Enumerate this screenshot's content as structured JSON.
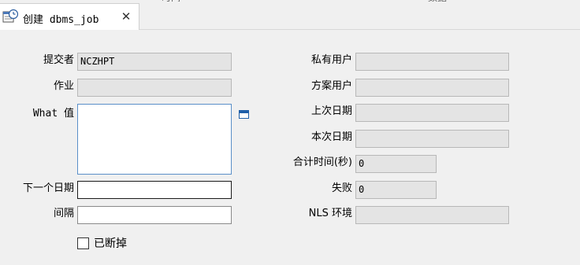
{
  "tab": {
    "title": "创建 dbms_job",
    "close_glyph": "✕",
    "icon": "calendar-clock-icon"
  },
  "top_fragments": [
    "时间",
    "数据"
  ],
  "form": {
    "submitter": {
      "label": "提交者",
      "value": "NCZHPT"
    },
    "job": {
      "label": "作业",
      "value": ""
    },
    "what": {
      "label": "What 值",
      "value": ""
    },
    "next_date": {
      "label": "下一个日期",
      "value": ""
    },
    "interval": {
      "label": "间隔",
      "value": ""
    },
    "broken": {
      "label": "已断掉",
      "checked": false
    },
    "private_user": {
      "label": "私有用户",
      "value": ""
    },
    "schema_user": {
      "label": "方案用户",
      "value": ""
    },
    "last_date": {
      "label": "上次日期",
      "value": ""
    },
    "this_date": {
      "label": "本次日期",
      "value": ""
    },
    "total_time": {
      "label": "合计时间(秒)",
      "value": "0"
    },
    "failures": {
      "label": "失败",
      "value": "0"
    },
    "nls_env": {
      "label": "NLS 环境",
      "value": ""
    }
  }
}
